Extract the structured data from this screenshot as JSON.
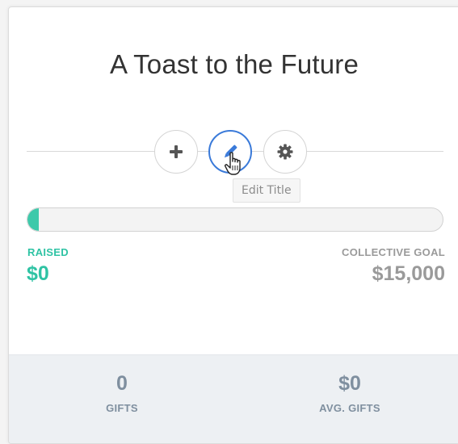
{
  "campaign": {
    "title": "A Toast to the Future"
  },
  "actions": {
    "add_icon": "plus-icon",
    "edit_icon": "pencil-icon",
    "settings_icon": "gear-icon",
    "active_color": "#3a7ad9"
  },
  "tooltip": {
    "text": "Edit Title"
  },
  "progress": {
    "fraction": 0.0,
    "fill_color": "#3ec9aa"
  },
  "raised": {
    "label": "RAISED",
    "value": "$0",
    "color": "#2fc3a4"
  },
  "goal": {
    "label": "COLLECTIVE GOAL",
    "value": "$15,000"
  },
  "stats": {
    "gifts": {
      "value": "0",
      "label": "GIFTS"
    },
    "avg_gifts": {
      "value": "$0",
      "label": "AVG. GIFTS"
    }
  }
}
